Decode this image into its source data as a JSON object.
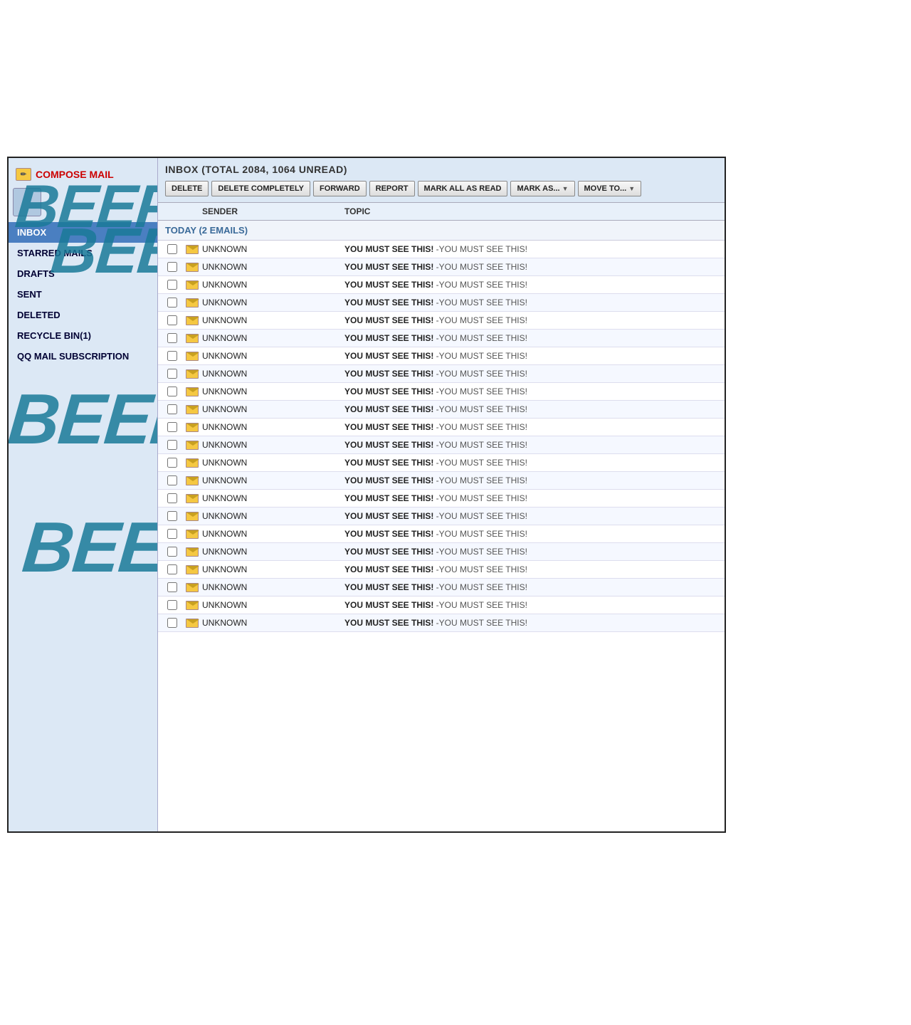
{
  "sidebar": {
    "compose_label": "COMPOSE MAIL",
    "nav_items": [
      {
        "id": "inbox",
        "label": "INBOX",
        "active": true
      },
      {
        "id": "starred",
        "label": "STARRED MAILS",
        "active": false
      },
      {
        "id": "drafts",
        "label": "DRAFTS",
        "active": false
      },
      {
        "id": "sent",
        "label": "SENT",
        "active": false
      },
      {
        "id": "deleted",
        "label": "DELETED",
        "active": false
      },
      {
        "id": "recycle",
        "label": "RECYCLE BIN(1)",
        "active": false
      },
      {
        "id": "qq",
        "label": "QQ MAIL SUBSCRIPTION",
        "active": false
      }
    ]
  },
  "toolbar": {
    "inbox_title": "INBOX (TOTAL 2084, 1064 UNREAD)",
    "buttons": [
      {
        "id": "delete",
        "label": "DELETE"
      },
      {
        "id": "delete-completely",
        "label": "DELETE COMPLETELY"
      },
      {
        "id": "forward",
        "label": "FORWARD"
      },
      {
        "id": "report",
        "label": "REPORT"
      },
      {
        "id": "mark-all-read",
        "label": "MARK ALL AS READ"
      },
      {
        "id": "mark-as",
        "label": "MARK AS...",
        "dropdown": true
      },
      {
        "id": "move-to",
        "label": "MOVE TO...",
        "dropdown": true
      }
    ]
  },
  "list": {
    "columns": [
      {
        "id": "check",
        "label": ""
      },
      {
        "id": "icon",
        "label": ""
      },
      {
        "id": "sender",
        "label": "SENDER"
      },
      {
        "id": "topic",
        "label": "TOPIC"
      }
    ],
    "sections": [
      {
        "id": "today",
        "label": "TODAY (2 EMAILS)",
        "emails": [
          {
            "sender": "UNKNOWN",
            "topic_bold": "YOU MUST SEE THIS!",
            "topic_rest": " -YOU MUST SEE THIS!"
          },
          {
            "sender": "UNKNOWN",
            "topic_bold": "YOU MUST SEE THIS!",
            "topic_rest": " -YOU MUST SEE THIS!"
          },
          {
            "sender": "UNKNOWN",
            "topic_bold": "YOU MUST SEE THIS!",
            "topic_rest": " -YOU MUST SEE THIS!"
          },
          {
            "sender": "UNKNOWN",
            "topic_bold": "YOU MUST SEE THIS!",
            "topic_rest": " -YOU MUST SEE THIS!"
          },
          {
            "sender": "UNKNOWN",
            "topic_bold": "YOU MUST SEE THIS!",
            "topic_rest": " -YOU MUST SEE THIS!"
          },
          {
            "sender": "UNKNOWN",
            "topic_bold": "YOU MUST SEE THIS!",
            "topic_rest": " -YOU MUST SEE THIS!"
          },
          {
            "sender": "UNKNOWN",
            "topic_bold": "YOU MUST SEE THIS!",
            "topic_rest": " -YOU MUST SEE THIS!"
          },
          {
            "sender": "UNKNOWN",
            "topic_bold": "YOU MUST SEE THIS!",
            "topic_rest": " -YOU MUST SEE THIS!"
          },
          {
            "sender": "UNKNOWN",
            "topic_bold": "YOU MUST SEE THIS!",
            "topic_rest": " -YOU MUST SEE THIS!"
          },
          {
            "sender": "UNKNOWN",
            "topic_bold": "YOU MUST SEE THIS!",
            "topic_rest": " -YOU MUST SEE THIS!"
          },
          {
            "sender": "UNKNOWN",
            "topic_bold": "YOU MUST SEE THIS!",
            "topic_rest": " -YOU MUST SEE THIS!"
          },
          {
            "sender": "UNKNOWN",
            "topic_bold": "YOU MUST SEE THIS!",
            "topic_rest": " -YOU MUST SEE THIS!"
          },
          {
            "sender": "UNKNOWN",
            "topic_bold": "YOU MUST SEE THIS!",
            "topic_rest": " -YOU MUST SEE THIS!"
          },
          {
            "sender": "UNKNOWN",
            "topic_bold": "YOU MUST SEE THIS!",
            "topic_rest": " -YOU MUST SEE THIS!"
          },
          {
            "sender": "UNKNOWN",
            "topic_bold": "YOU MUST SEE THIS!",
            "topic_rest": " -YOU MUST SEE THIS!"
          },
          {
            "sender": "UNKNOWN",
            "topic_bold": "YOU MUST SEE THIS!",
            "topic_rest": " -YOU MUST SEE THIS!"
          },
          {
            "sender": "UNKNOWN",
            "topic_bold": "YOU MUST SEE THIS!",
            "topic_rest": " -YOU MUST SEE THIS!"
          },
          {
            "sender": "UNKNOWN",
            "topic_bold": "YOU MUST SEE THIS!",
            "topic_rest": " -YOU MUST SEE THIS!"
          },
          {
            "sender": "UNKNOWN",
            "topic_bold": "YOU MUST SEE THIS!",
            "topic_rest": " -YOU MUST SEE THIS!"
          },
          {
            "sender": "UNKNOWN",
            "topic_bold": "YOU MUST SEE THIS!",
            "topic_rest": " -YOU MUST SEE THIS!"
          },
          {
            "sender": "UNKNOWN",
            "topic_bold": "YOU MUST SEE THIS!",
            "topic_rest": " -YOU MUST SEE THIS!"
          },
          {
            "sender": "UNKNOWN",
            "topic_bold": "YOU MUST SEE THIS!",
            "topic_rest": " -YOU MUST SEE THIS!"
          }
        ]
      }
    ]
  },
  "beep_texts": [
    "BEEP",
    "BEEP",
    "BEEP",
    "BEEP"
  ]
}
